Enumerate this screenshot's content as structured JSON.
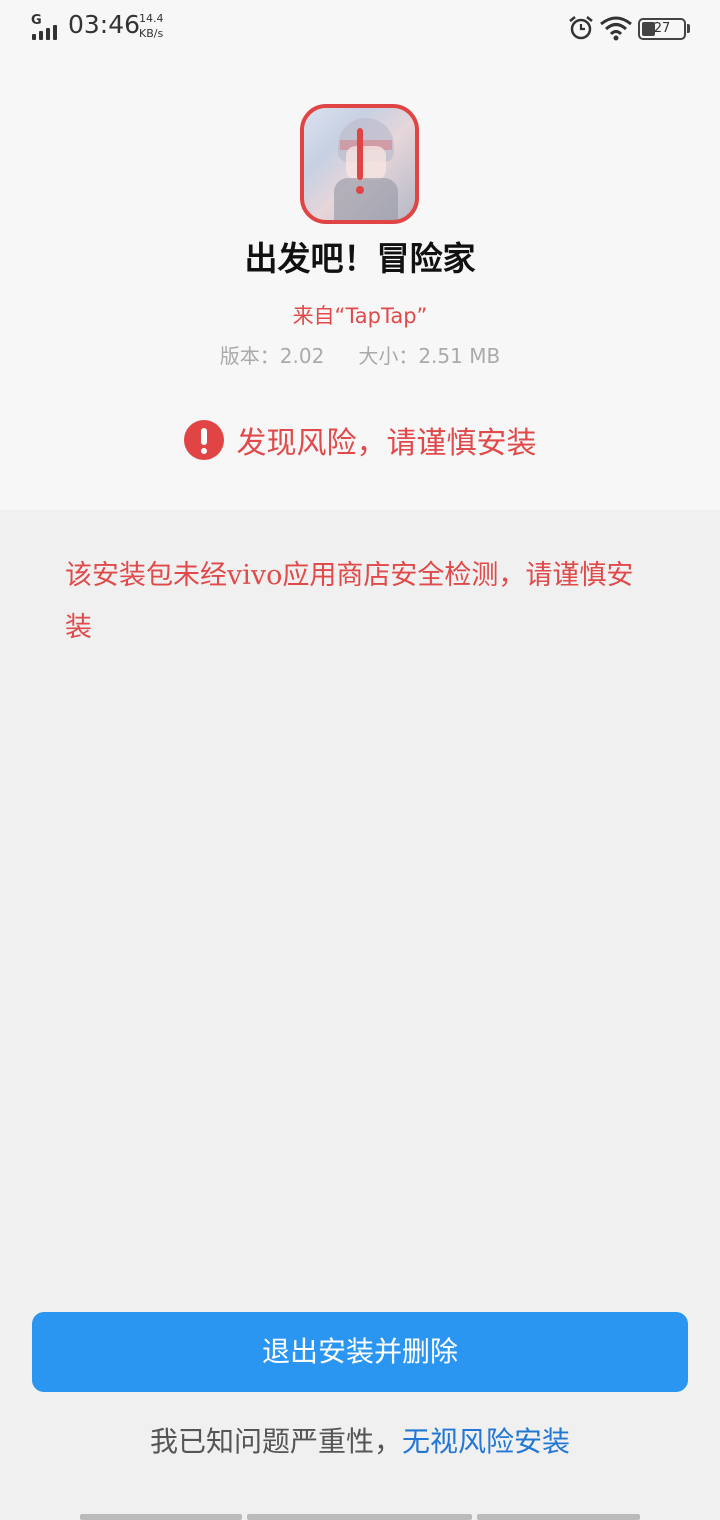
{
  "status_bar": {
    "network_type": "G",
    "time": "03:46",
    "net_speed_value": "14.4",
    "net_speed_unit": "KB/s",
    "battery_level": "27"
  },
  "app": {
    "name": "出发吧！冒险家",
    "source": "来自“TapTap”",
    "version_label": "版本：",
    "version_value": "2.02",
    "size_label": "大小：",
    "size_value": "2.51 MB"
  },
  "risk": {
    "headline": "发现风险，请谨慎安装",
    "detail": "该安装包未经vivo应用商店安全检测，请谨慎安装"
  },
  "actions": {
    "exit_label": "退出安装并删除",
    "ignore_prefix": "我已知问题严重性，",
    "ignore_link": "无视风险安装"
  },
  "colors": {
    "danger": "#e04444",
    "primary": "#2a96f2",
    "link": "#2377d4"
  }
}
